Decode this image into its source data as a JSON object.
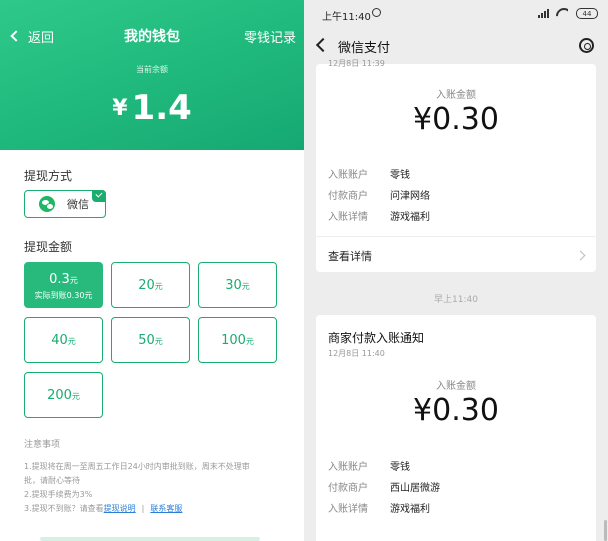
{
  "wallet": {
    "nav": {
      "back": "返回",
      "title": "我的钱包",
      "right": "零钱记录"
    },
    "balance_caption": "当前余额",
    "balance_currency": "¥",
    "balance_amount": "1.4",
    "method_title": "提现方式",
    "method_label": "微信",
    "amount_title": "提现金额",
    "unit": "元",
    "amounts": [
      {
        "value": "0.3",
        "sub": "实际到账0.30元",
        "selected": true
      },
      {
        "value": "20"
      },
      {
        "value": "30"
      },
      {
        "value": "40"
      },
      {
        "value": "50"
      },
      {
        "value": "100"
      },
      {
        "value": "200"
      }
    ],
    "notes_title": "注意事项",
    "notes": [
      "1.提现将在周一至周五工作日24小时内审批到账，周末不处理审",
      "批，请耐心等待",
      "2.提现手续费为3%"
    ],
    "note3_prefix": "3.提现不到账？请查看",
    "note3_link1": "提现说明",
    "note3_sep": "|",
    "note3_link2": "联系客服"
  },
  "wechat": {
    "status": {
      "time": "上午11:40",
      "battery": "44"
    },
    "nav_title": "微信支付",
    "card1": {
      "clipped_date": "12月8日 11:39",
      "amount_caption": "入账金额",
      "amount": "¥0.30",
      "rows": [
        {
          "k": "入账账户",
          "v": "零钱"
        },
        {
          "k": "付款商户",
          "v": "问津网络"
        },
        {
          "k": "入账详情",
          "v": "游戏福利"
        }
      ],
      "detail": "查看详情"
    },
    "timestamp": "早上11:40",
    "card2": {
      "title": "商家付款入账通知",
      "date": "12月8日 11:40",
      "amount_caption": "入账金额",
      "amount": "¥0.30",
      "rows": [
        {
          "k": "入账账户",
          "v": "零钱"
        },
        {
          "k": "付款商户",
          "v": "西山居微游"
        },
        {
          "k": "入账详情",
          "v": "游戏福利"
        }
      ]
    }
  }
}
